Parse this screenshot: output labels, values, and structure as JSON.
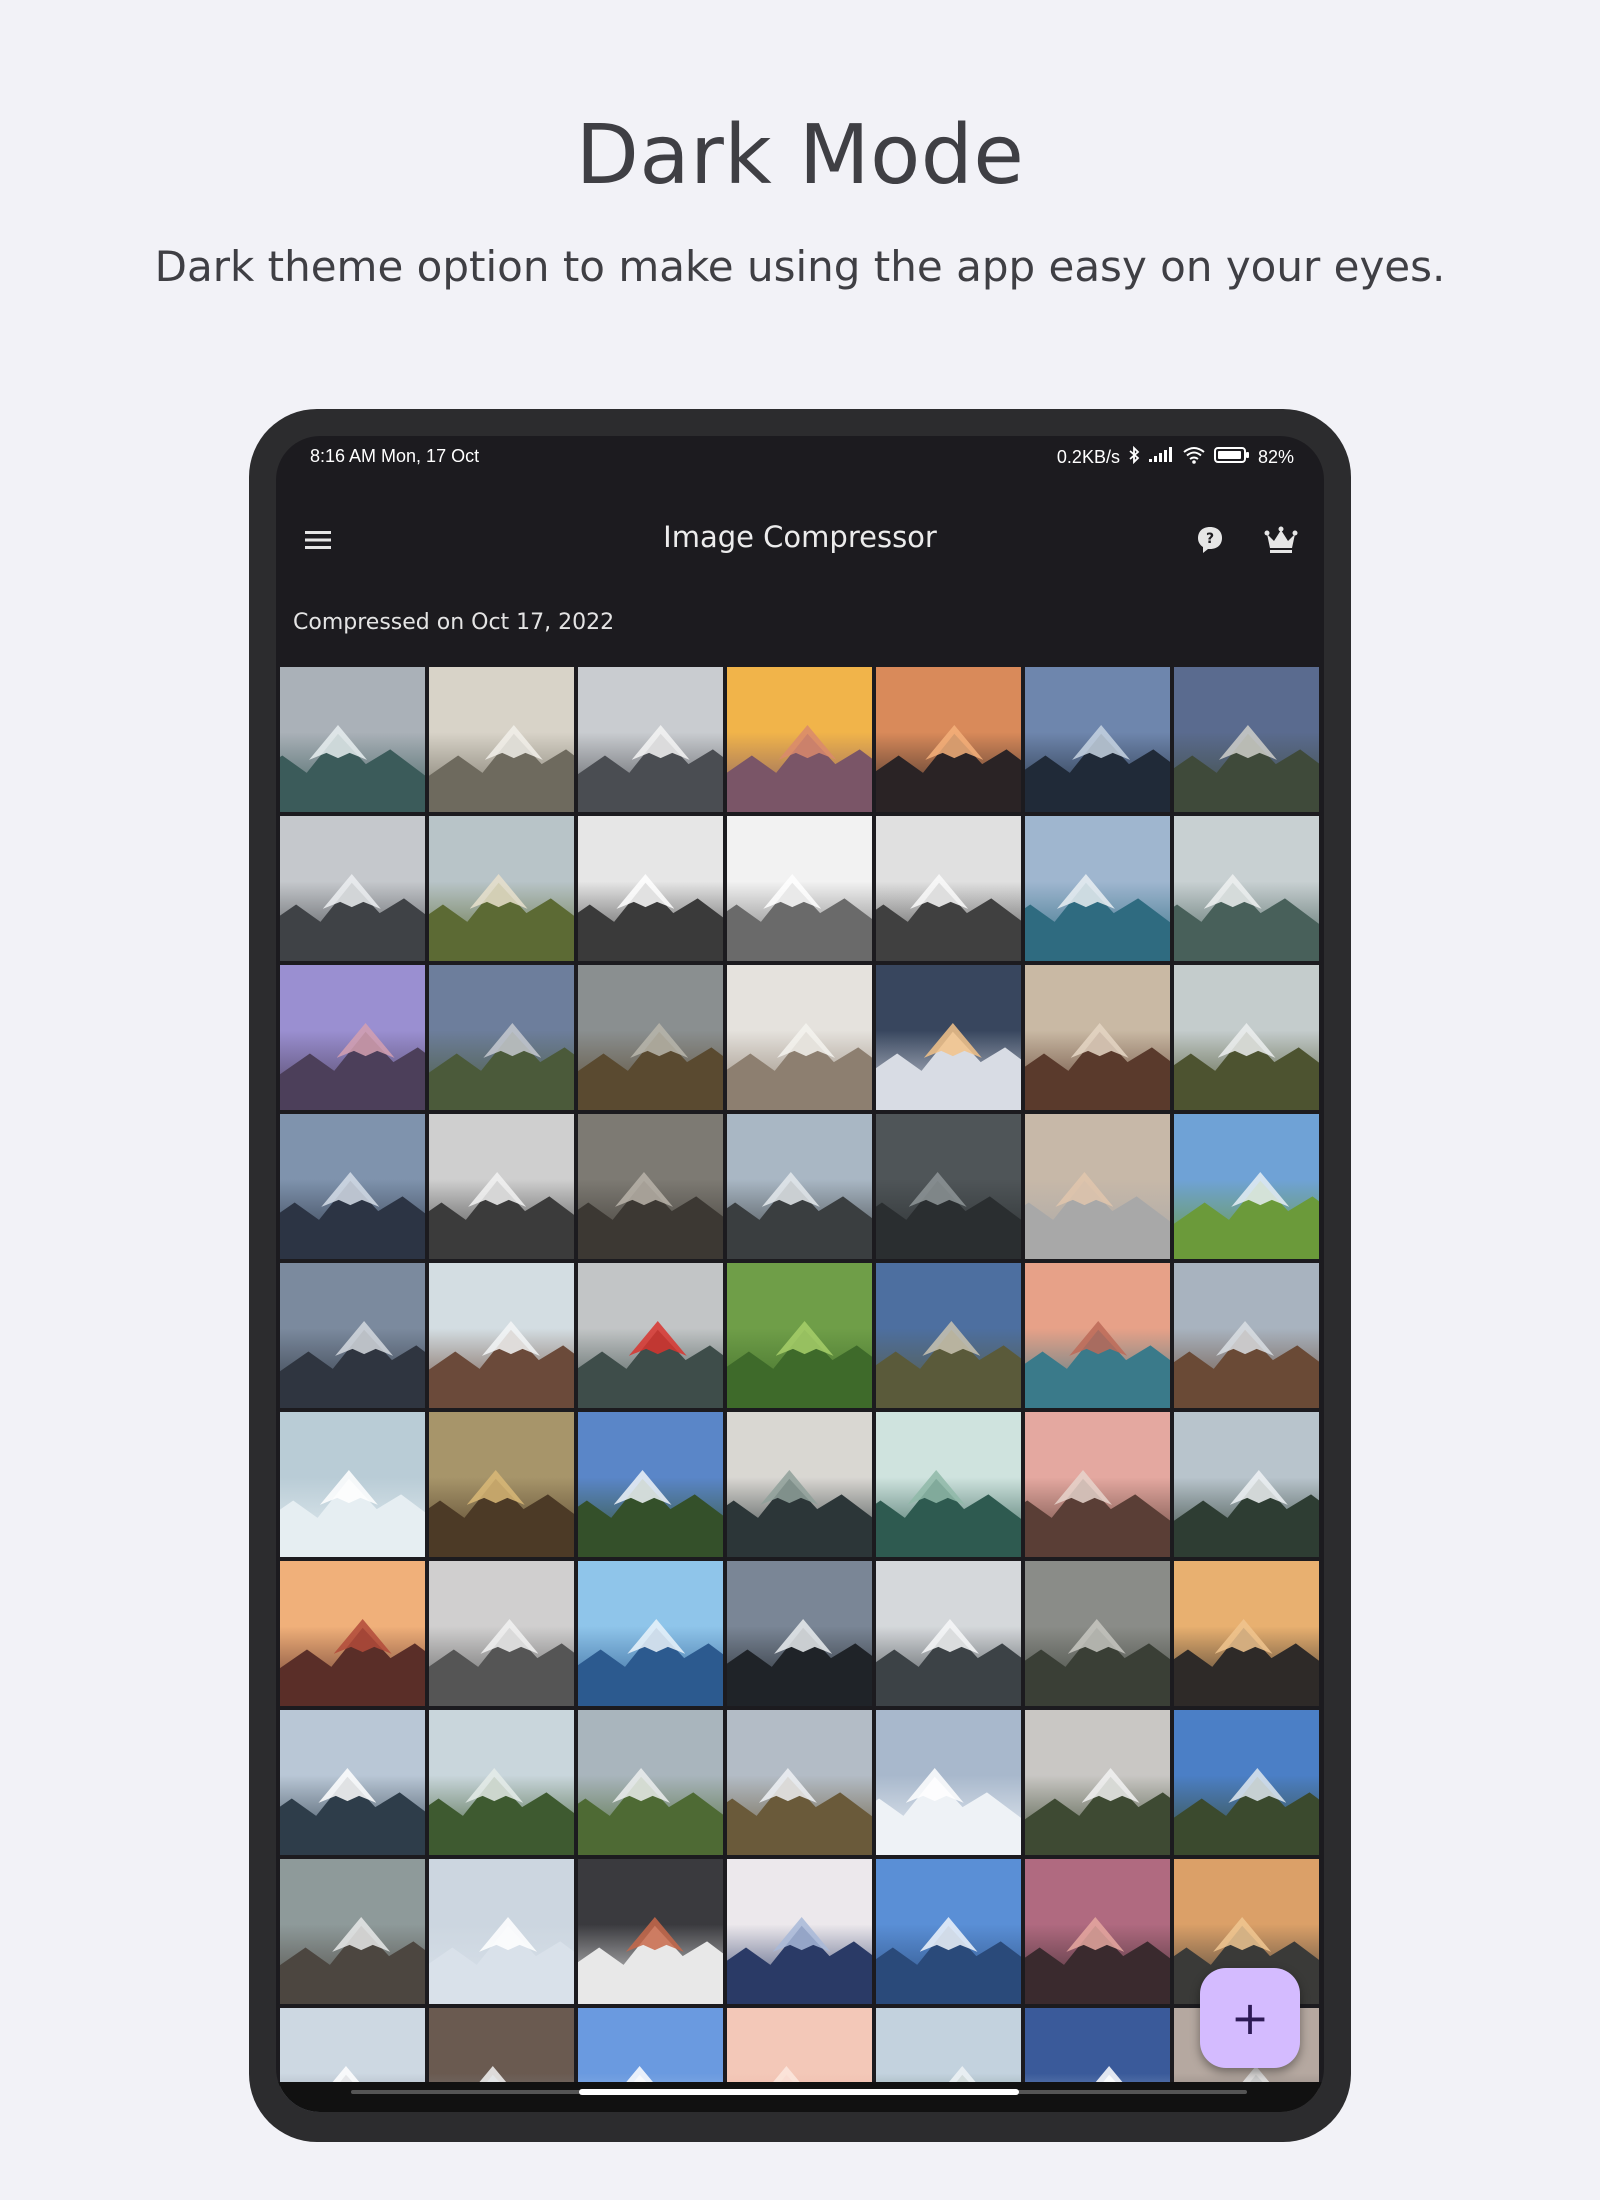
{
  "marketing": {
    "title": "Dark Mode",
    "subtitle": "Dark theme option to make using the app easy on your eyes."
  },
  "status_bar": {
    "time": "8:16 AM  Mon, 17 Oct",
    "net_speed": "0.2KB/s",
    "battery": "82%"
  },
  "app_bar": {
    "title": "Image Compressor",
    "menu_icon": "menu-icon",
    "help_icon": "help-icon",
    "premium_icon": "crown-icon"
  },
  "gallery": {
    "section_title": "Compressed on Oct 17, 2022",
    "thumbnails": [
      {
        "sky": "#aab1b8",
        "land": "#3b5b5a",
        "snow": "#e8eef0"
      },
      {
        "sky": "#d8d3c8",
        "land": "#6e6a5e",
        "snow": "#f2f0ea"
      },
      {
        "sky": "#c9ccd0",
        "land": "#4a4d52",
        "snow": "#f4f4f4"
      },
      {
        "sky": "#f1b44a",
        "land": "#7a5567",
        "snow": "#d98a6c"
      },
      {
        "sky": "#d98a5a",
        "land": "#2a2325",
        "snow": "#f4b07a"
      },
      {
        "sky": "#6e86ad",
        "land": "#202a38",
        "snow": "#c7d3e2"
      },
      {
        "sky": "#5a6b8f",
        "land": "#3f4a3a",
        "snow": "#cfcfca"
      },
      {
        "sky": "#c5c8cc",
        "land": "#3f4246",
        "snow": "#eceff1"
      },
      {
        "sky": "#b8c4c8",
        "land": "#5c6a34",
        "snow": "#e8e1cc"
      },
      {
        "sky": "#e6e6e6",
        "land": "#3a3a3a",
        "snow": "#ffffff"
      },
      {
        "sky": "#f2f2f2",
        "land": "#6a6a6a",
        "snow": "#ffffff"
      },
      {
        "sky": "#e0e0e0",
        "land": "#404040",
        "snow": "#fafafa"
      },
      {
        "sky": "#9fb6cf",
        "land": "#2f6b80",
        "snow": "#e9eef2"
      },
      {
        "sky": "#c8d0d2",
        "land": "#48605a",
        "snow": "#eef1f1"
      },
      {
        "sky": "#9a8fd1",
        "land": "#4c3f5a",
        "snow": "#d4a0b0"
      },
      {
        "sky": "#6d7e9c",
        "land": "#4b5a3a",
        "snow": "#c5c9d0"
      },
      {
        "sky": "#8a8f90",
        "land": "#5a4a30",
        "snow": "#b8b6ac"
      },
      {
        "sky": "#e5e2dd",
        "land": "#8d7f70",
        "snow": "#f5f3ef"
      },
      {
        "sky": "#38465e",
        "land": "#d8dce4",
        "snow": "#f3c38a"
      },
      {
        "sky": "#c9b9a4",
        "land": "#5a3a2c",
        "snow": "#e5d6c4"
      },
      {
        "sky": "#c4cccc",
        "land": "#4d5330",
        "snow": "#ecefef"
      },
      {
        "sky": "#7f93ad",
        "land": "#2c3444",
        "snow": "#d5dde7"
      },
      {
        "sky": "#cfcfcf",
        "land": "#3b3b3b",
        "snow": "#f2f2f2"
      },
      {
        "sky": "#7d7a73",
        "land": "#3c3833",
        "snow": "#b8b3a9"
      },
      {
        "sky": "#a9b7c4",
        "land": "#3a3e40",
        "snow": "#e4e9ec"
      },
      {
        "sky": "#4f5558",
        "land": "#2a2e30",
        "snow": "#8e9598"
      },
      {
        "sky": "#c7b8a8",
        "land": "#a8a8a8",
        "snow": "#e1c6ad"
      },
      {
        "sky": "#6fa2d6",
        "land": "#6b9a3a",
        "snow": "#e6eef4"
      },
      {
        "sky": "#7b8a9e",
        "land": "#2f3540",
        "snow": "#d3d8de"
      },
      {
        "sky": "#d3dde2",
        "land": "#6b4a3a",
        "snow": "#f3f6f7"
      },
      {
        "sky": "#c2c5c6",
        "land": "#3e4d4a",
        "snow": "#d8342e"
      },
      {
        "sky": "#6f9e48",
        "land": "#3e6a2a",
        "snow": "#a7cf6a"
      },
      {
        "sky": "#4d6fa0",
        "land": "#5a5a3a",
        "snow": "#c9c3b1"
      },
      {
        "sky": "#e7a188",
        "land": "#3a7a8a",
        "snow": "#bc6a58"
      },
      {
        "sky": "#a8b3bf",
        "land": "#6a4a36",
        "snow": "#d9dee3"
      },
      {
        "sky": "#b9ccd6",
        "land": "#e6eef2",
        "snow": "#ffffff"
      },
      {
        "sky": "#a7956a",
        "land": "#4c3a26",
        "snow": "#d9b877"
      },
      {
        "sky": "#5a86c8",
        "land": "#34502a",
        "snow": "#eef3f8"
      },
      {
        "sky": "#d9d7d2",
        "land": "#2c3638",
        "snow": "#8fa09a"
      },
      {
        "sky": "#cfe3de",
        "land": "#2e5a50",
        "snow": "#8fb8a8"
      },
      {
        "sky": "#e4a8a0",
        "land": "#5a3e36",
        "snow": "#e6d3cb"
      },
      {
        "sky": "#b8c4cc",
        "land": "#2e3d33",
        "snow": "#eef2f4"
      },
      {
        "sky": "#f0b07a",
        "land": "#5a2e28",
        "snow": "#b24a3a"
      },
      {
        "sky": "#d0cfcf",
        "land": "#555555",
        "snow": "#f2f2f2"
      },
      {
        "sky": "#8fc5ea",
        "land": "#2c5a8f",
        "snow": "#eaf3fa"
      },
      {
        "sky": "#7a8696",
        "land": "#1f2328",
        "snow": "#e9ecef"
      },
      {
        "sky": "#d5d8db",
        "land": "#3c4246",
        "snow": "#f7f8f9"
      },
      {
        "sky": "#8a8c88",
        "land": "#3a3f36",
        "snow": "#c7c7c1"
      },
      {
        "sky": "#e8b070",
        "land": "#2e2a28",
        "snow": "#f0c48e"
      },
      {
        "sky": "#b9c7d6",
        "land": "#2e3d4a",
        "snow": "#ffffff"
      },
      {
        "sky": "#c9d6dc",
        "land": "#3e5a30",
        "snow": "#e5ece9"
      },
      {
        "sky": "#a9b5bd",
        "land": "#4e6a34",
        "snow": "#ecefef"
      },
      {
        "sky": "#b3bcc6",
        "land": "#6a5a3a",
        "snow": "#eef1f4"
      },
      {
        "sky": "#a8b8cc",
        "land": "#eef2f6",
        "snow": "#ffffff"
      },
      {
        "sky": "#c9c7c4",
        "land": "#3e4a33",
        "snow": "#f2f2f2"
      },
      {
        "sky": "#4b7fc6",
        "land": "#3b4a2e",
        "snow": "#dfe8ef"
      },
      {
        "sky": "#8e9a9a",
        "land": "#4c4640",
        "snow": "#e7e9e9"
      },
      {
        "sky": "#ccd6e0",
        "land": "#d9e1ea",
        "snow": "#ffffff"
      },
      {
        "sky": "#3a3a3e",
        "land": "#e8e8e8",
        "snow": "#c8694a"
      },
      {
        "sky": "#ece8ec",
        "land": "#2a3a66",
        "snow": "#a8b8d8"
      },
      {
        "sky": "#5a8fd6",
        "land": "#2a4a7a",
        "snow": "#eef4fb"
      },
      {
        "sky": "#b06a80",
        "land": "#3a2a2e",
        "snow": "#e6a8a0"
      },
      {
        "sky": "#dba068",
        "land": "#3a3a38",
        "snow": "#f0c792"
      },
      {
        "sky": "#cdd8e2",
        "land": "#5a6270",
        "snow": "#ffffff"
      },
      {
        "sky": "#6a5a50",
        "land": "#8a9aa8",
        "snow": "#f2f2f2"
      },
      {
        "sky": "#6a9ae0",
        "land": "#c8d6ea",
        "snow": "#ffffff"
      },
      {
        "sky": "#f3c8b8",
        "land": "#e6a296",
        "snow": "#fbe7de"
      },
      {
        "sky": "#c3d2de",
        "land": "#3a5a4a",
        "snow": "#eef3f6"
      },
      {
        "sky": "#3a5a9a",
        "land": "#d8e2ec",
        "snow": "#ffffff"
      },
      {
        "sky": "#b5a8a0",
        "land": "#3a3a3a",
        "snow": "#e6e6e6"
      }
    ]
  },
  "fab": {
    "label": "+"
  }
}
